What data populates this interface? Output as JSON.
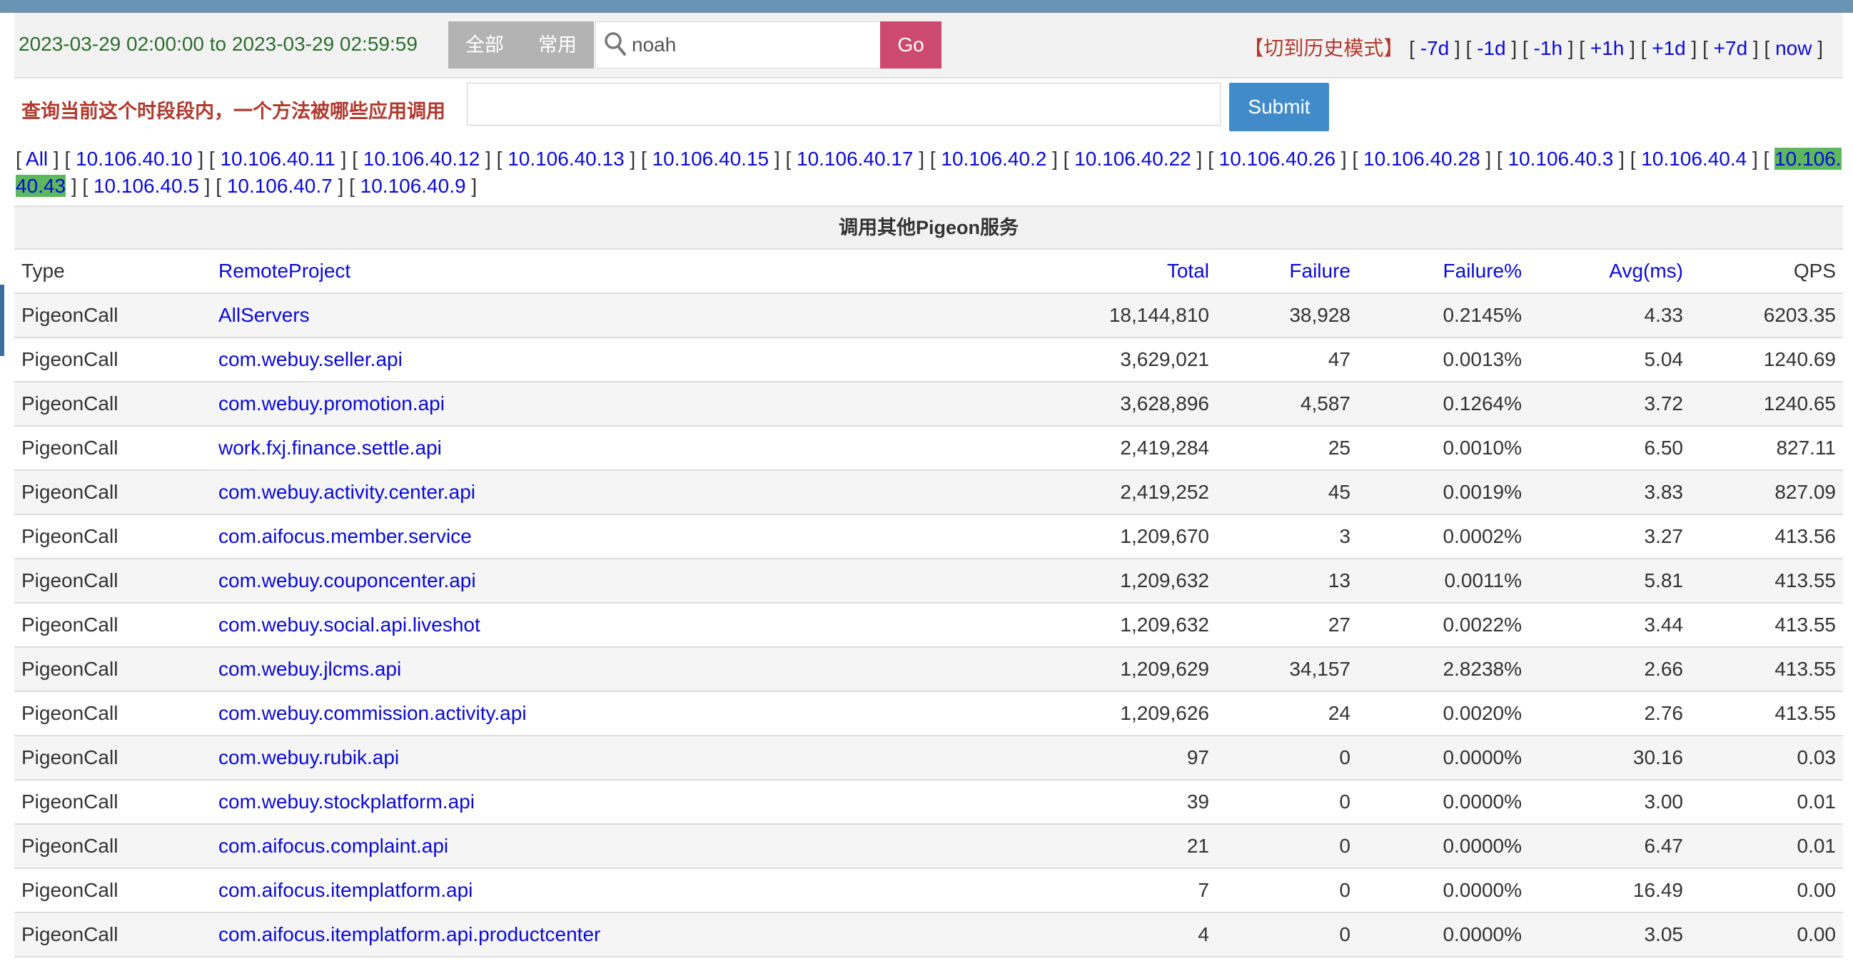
{
  "time_range": "2023-03-29 02:00:00 to 2023-03-29 02:59:59",
  "filter_buttons": {
    "all": "全部",
    "common": "常用"
  },
  "search": {
    "value": "noah",
    "button": "Go"
  },
  "history_mode": "【切到历史模式】",
  "time_nav": [
    "-7d",
    "-1d",
    "-1h",
    "+1h",
    "+1d",
    "+7d",
    "now"
  ],
  "method_query": {
    "label": "查询当前这个时段段内，一个方法被哪些应用调用",
    "value": "",
    "submit": "Submit"
  },
  "ip_filters": [
    {
      "label": "All",
      "active": false
    },
    {
      "label": "10.106.40.10",
      "active": false
    },
    {
      "label": "10.106.40.11",
      "active": false
    },
    {
      "label": "10.106.40.12",
      "active": false
    },
    {
      "label": "10.106.40.13",
      "active": false
    },
    {
      "label": "10.106.40.15",
      "active": false
    },
    {
      "label": "10.106.40.17",
      "active": false
    },
    {
      "label": "10.106.40.2",
      "active": false
    },
    {
      "label": "10.106.40.22",
      "active": false
    },
    {
      "label": "10.106.40.26",
      "active": false
    },
    {
      "label": "10.106.40.28",
      "active": false
    },
    {
      "label": "10.106.40.3",
      "active": false
    },
    {
      "label": "10.106.40.4",
      "active": false
    },
    {
      "label": "10.106.40.43",
      "active": true
    },
    {
      "label": "10.106.40.5",
      "active": false
    },
    {
      "label": "10.106.40.7",
      "active": false
    },
    {
      "label": "10.106.40.9",
      "active": false
    }
  ],
  "section_title": "调用其他Pigeon服务",
  "table": {
    "headers": [
      "Type",
      "RemoteProject",
      "Total",
      "Failure",
      "Failure%",
      "Avg(ms)",
      "QPS"
    ],
    "rows": [
      [
        "PigeonCall",
        "AllServers",
        "18,144,810",
        "38,928",
        "0.2145%",
        "4.33",
        "6203.35"
      ],
      [
        "PigeonCall",
        "com.webuy.seller.api",
        "3,629,021",
        "47",
        "0.0013%",
        "5.04",
        "1240.69"
      ],
      [
        "PigeonCall",
        "com.webuy.promotion.api",
        "3,628,896",
        "4,587",
        "0.1264%",
        "3.72",
        "1240.65"
      ],
      [
        "PigeonCall",
        "work.fxj.finance.settle.api",
        "2,419,284",
        "25",
        "0.0010%",
        "6.50",
        "827.11"
      ],
      [
        "PigeonCall",
        "com.webuy.activity.center.api",
        "2,419,252",
        "45",
        "0.0019%",
        "3.83",
        "827.09"
      ],
      [
        "PigeonCall",
        "com.aifocus.member.service",
        "1,209,670",
        "3",
        "0.0002%",
        "3.27",
        "413.56"
      ],
      [
        "PigeonCall",
        "com.webuy.couponcenter.api",
        "1,209,632",
        "13",
        "0.0011%",
        "5.81",
        "413.55"
      ],
      [
        "PigeonCall",
        "com.webuy.social.api.liveshot",
        "1,209,632",
        "27",
        "0.0022%",
        "3.44",
        "413.55"
      ],
      [
        "PigeonCall",
        "com.webuy.jlcms.api",
        "1,209,629",
        "34,157",
        "2.8238%",
        "2.66",
        "413.55"
      ],
      [
        "PigeonCall",
        "com.webuy.commission.activity.api",
        "1,209,626",
        "24",
        "0.0020%",
        "2.76",
        "413.55"
      ],
      [
        "PigeonCall",
        "com.webuy.rubik.api",
        "97",
        "0",
        "0.0000%",
        "30.16",
        "0.03"
      ],
      [
        "PigeonCall",
        "com.webuy.stockplatform.api",
        "39",
        "0",
        "0.0000%",
        "3.00",
        "0.01"
      ],
      [
        "PigeonCall",
        "com.aifocus.complaint.api",
        "21",
        "0",
        "0.0000%",
        "6.47",
        "0.01"
      ],
      [
        "PigeonCall",
        "com.aifocus.itemplatform.api",
        "7",
        "0",
        "0.0000%",
        "16.49",
        "0.00"
      ],
      [
        "PigeonCall",
        "com.aifocus.itemplatform.api.productcenter",
        "4",
        "0",
        "0.0000%",
        "3.05",
        "0.00"
      ]
    ]
  },
  "colors": {
    "accent_go": "#cc4a70",
    "submit": "#428bca",
    "active_ip": "#5cb85c",
    "link": "#0a0ad6",
    "history": "#b03a2e"
  }
}
